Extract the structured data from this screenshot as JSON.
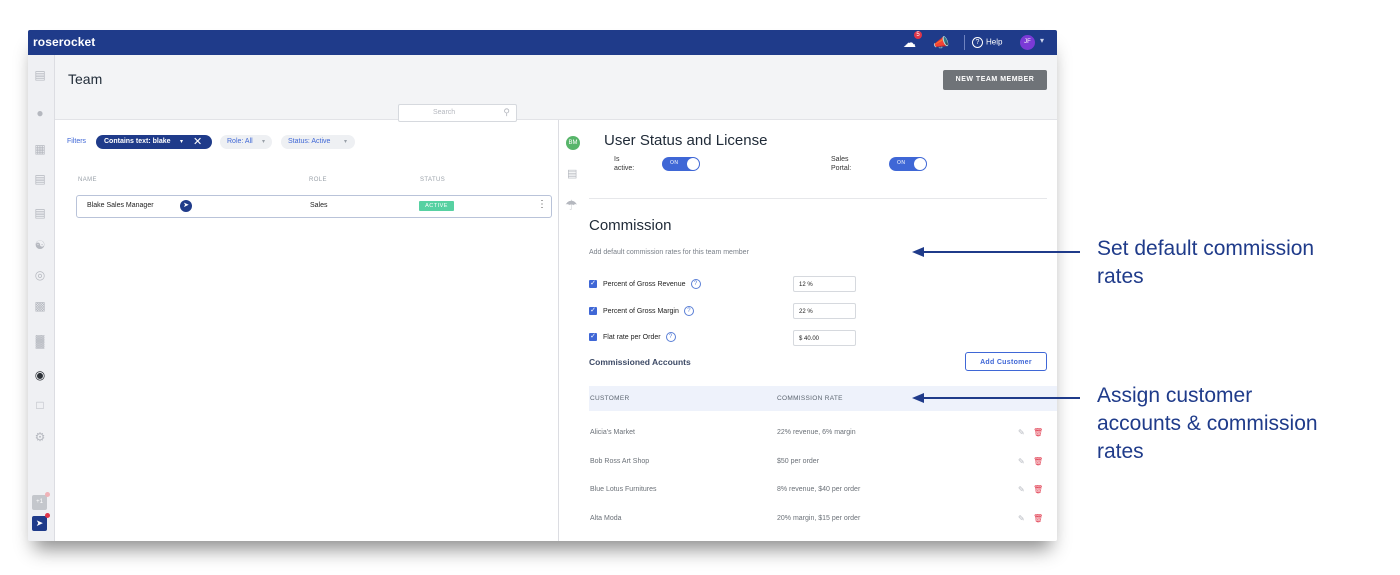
{
  "app": {
    "brand": "roserocket",
    "help_label": "Help",
    "avatar_initials": "JF",
    "notification_count": "5"
  },
  "page": {
    "title": "Team",
    "new_member_button": "NEW TEAM MEMBER"
  },
  "filters": {
    "label": "Filters",
    "chip_text": "Contains text: blake",
    "role": "Role: All",
    "status": "Status: Active",
    "search_placeholder": "Search"
  },
  "table": {
    "headers": [
      "NAME",
      "ROLE",
      "STATUS"
    ],
    "rows": [
      {
        "name": "Blake Sales Manager",
        "role": "Sales",
        "status": "ACTIVE"
      }
    ]
  },
  "middle": {
    "avatar": "BM"
  },
  "detail": {
    "user_status_title": "User Status and License",
    "is_active_label_1": "Is",
    "is_active_label_2": "active:",
    "sales_portal_label_1": "Sales",
    "sales_portal_label_2": "Portal:",
    "toggle_on": "ON",
    "commission_title": "Commission",
    "commission_desc": "Add default commission rates for this team member",
    "rates": [
      {
        "label": "Percent of Gross Revenue",
        "value": "12 %"
      },
      {
        "label": "Percent of Gross Margin",
        "value": "22 %"
      },
      {
        "label": "Flat rate per Order",
        "value": "$ 40.00"
      }
    ],
    "commissioned_accounts_title": "Commissioned Accounts",
    "add_customer_button": "Add Customer",
    "columns": [
      "CUSTOMER",
      "COMMISSION RATE"
    ],
    "accounts": [
      {
        "customer": "Alicia's Market",
        "rate": "22% revenue, 6% margin"
      },
      {
        "customer": "Bob Ross Art Shop",
        "rate": "$50 per order"
      },
      {
        "customer": "Blue Lotus Furnitures",
        "rate": "8% revenue, $40 per order"
      },
      {
        "customer": "Alta Moda",
        "rate": "20% margin, $15 per order"
      }
    ]
  },
  "sidebar_mini": {
    "badge": "+1"
  },
  "annotations": {
    "callout_1_line1": "Set default commission",
    "callout_1_line2": "rates",
    "callout_2_line1": "Assign customer",
    "callout_2_line2": "accounts & commission",
    "callout_2_line3": "rates"
  },
  "colors": {
    "brand": "#1f3b8a",
    "accent": "#3f67d6",
    "active": "#57d1a2",
    "delete": "#e0364a"
  }
}
